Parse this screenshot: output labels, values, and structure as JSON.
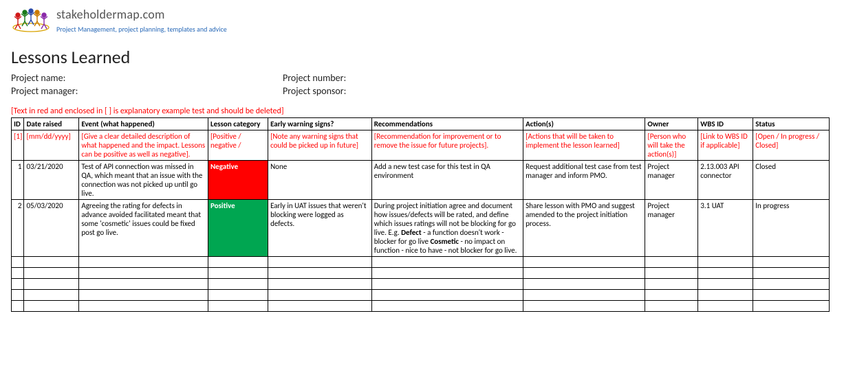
{
  "branding": {
    "site_name": "stakeholdermap.com",
    "tagline": "Project Management, project planning, templates and advice",
    "logo_alt": "stakeholdermap logo"
  },
  "title": "Lessons Learned",
  "meta": {
    "project_name_label": "Project name:",
    "project_number_label": "Project number:",
    "project_manager_label": "Project manager:",
    "project_sponsor_label": "Project sponsor:",
    "project_name_value": "",
    "project_number_value": "",
    "project_manager_value": "",
    "project_sponsor_value": ""
  },
  "explanatory_note": "[Text in red and enclosed in [ ] is explanatory example test and should be deleted]",
  "columns": {
    "id": "ID",
    "date": "Date raised",
    "event": "Event (what happened)",
    "category": "Lesson category",
    "warning": "Early warning signs?",
    "recommendations": "Recommendations",
    "actions": "Action(s)",
    "owner": "Owner",
    "wbs": "WBS ID",
    "status": "Status"
  },
  "hint_row": {
    "id": "[1]",
    "date": "[mm/dd/yyyy]",
    "event": "[Give a clear detailed description of what happened and the impact. Lessons can be positive as well as negative].",
    "category": "[Positive / negative /",
    "warning": "[Note any warning signs that could be picked up in future]",
    "recommendations": "[Recommendation for improvement or to remove the issue for future projects].",
    "actions": "[Actions that will be taken to implement the lesson learned]",
    "owner": "[Person who will take the action(s)]",
    "wbs": "[Link to WBS ID if applicable]",
    "status": "[Open / In progress / Closed]"
  },
  "rows": [
    {
      "id": "1",
      "date": "03/21/2020",
      "event": "Test of API connection was missed in QA, which meant that an issue with the connection was not picked up until go live.",
      "category": "Negative",
      "category_kind": "neg",
      "warning": "None",
      "recommendations": "Add a new test case for this test in QA environment",
      "actions": "Request additional test case from test manager and inform PMO.",
      "owner": "Project manager",
      "wbs": "2.13.003 API connector",
      "status": "Closed"
    },
    {
      "id": "2",
      "date": "05/03/2020",
      "event": "Agreeing the rating for defects in advance avoided facilitated meant that some 'cosmetic' issues could be fixed post go live.",
      "category": "Positive",
      "category_kind": "pos",
      "warning": "Early in UAT issues that weren't blocking were logged as defects.",
      "recommendations_html": "During project initiation agree and document how issues/defects will be rated, and define which issues ratings will not be blocking for go live. E.g. <b>Defect</b> - a function doesn't work - blocker for go live <b>Cosmetic</b> - no impact on function - nice to have - not blocker for go live.",
      "actions": "Share lesson with PMO and suggest amended to the project initiation process.",
      "owner": "Project manager",
      "wbs": "3.1 UAT",
      "status": "In progress"
    }
  ],
  "empty_row_count": 5
}
